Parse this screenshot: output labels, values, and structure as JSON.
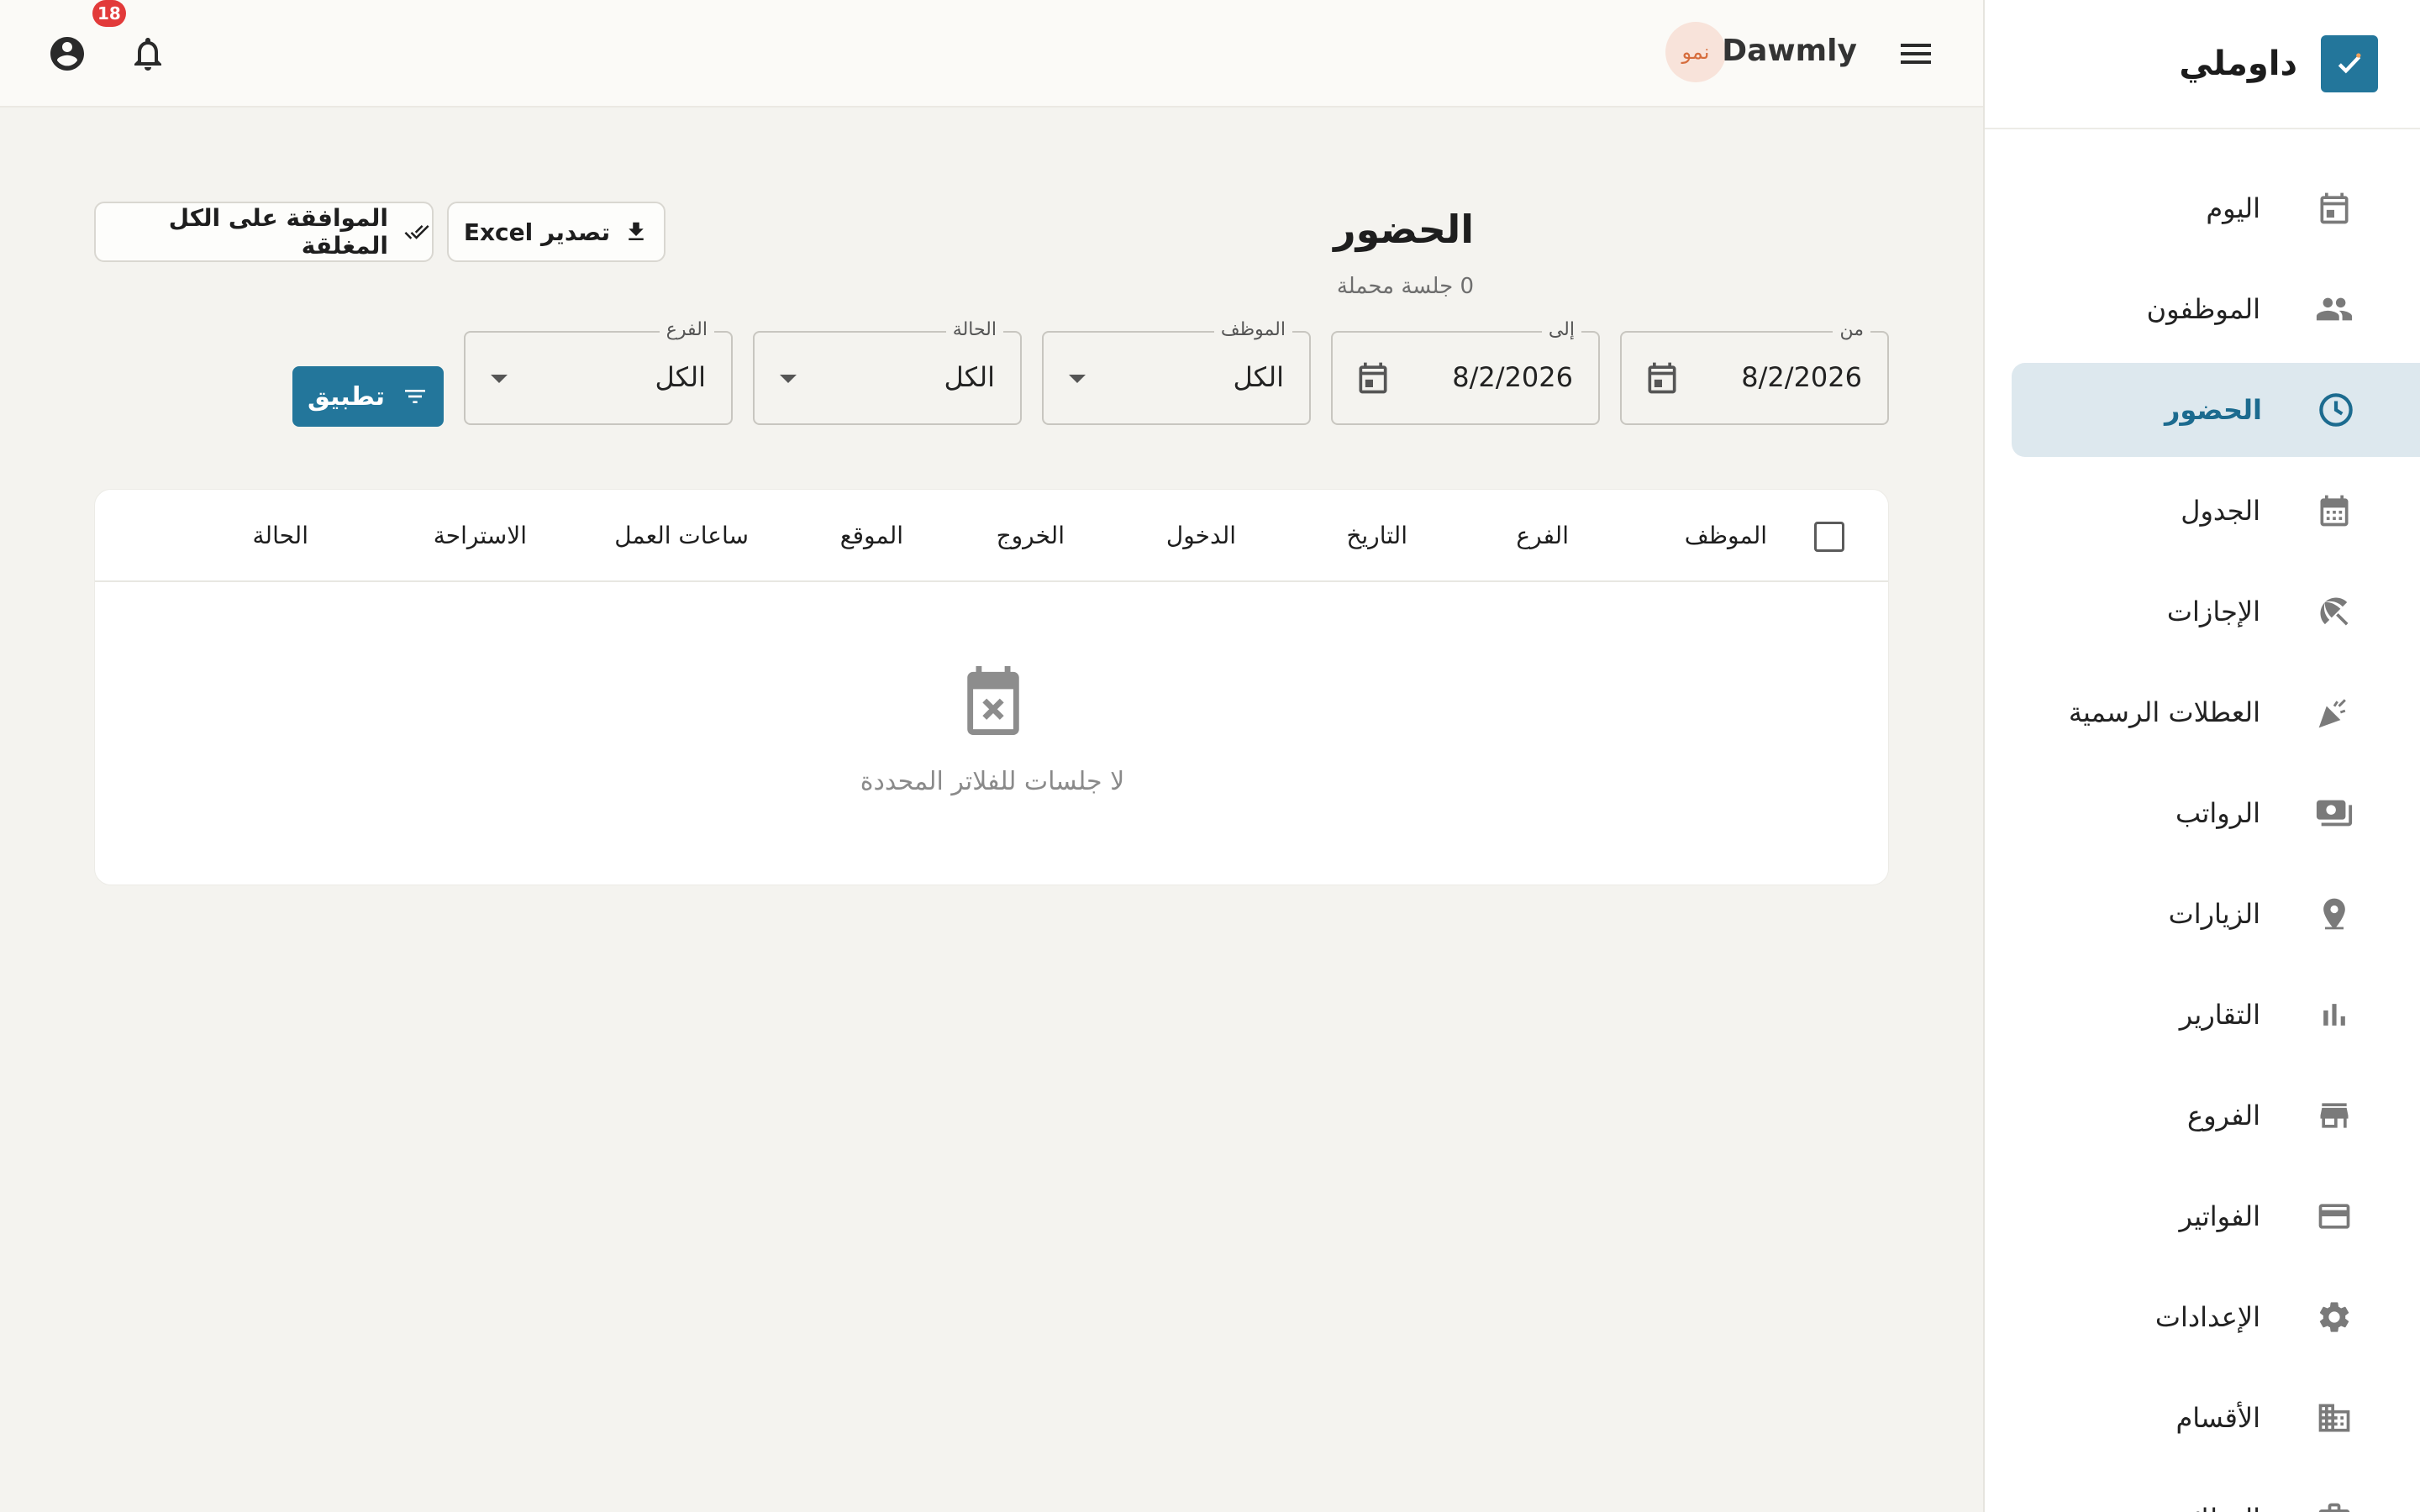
{
  "app": {
    "brand_name": "داوملي",
    "title": "Dawmly",
    "avatar_text": "نمو",
    "notification_count": "18"
  },
  "sidebar": {
    "items": [
      {
        "label": "اليوم",
        "icon": "calendar-today-icon",
        "active": false
      },
      {
        "label": "الموظفون",
        "icon": "people-icon",
        "active": false
      },
      {
        "label": "الحضور",
        "icon": "clock-icon",
        "active": true
      },
      {
        "label": "الجدول",
        "icon": "calendar-grid-icon",
        "active": false
      },
      {
        "label": "الإجازات",
        "icon": "umbrella-icon",
        "active": false
      },
      {
        "label": "العطلات الرسمية",
        "icon": "party-popper-icon",
        "active": false
      },
      {
        "label": "الرواتب",
        "icon": "money-icon",
        "active": false
      },
      {
        "label": "الزيارات",
        "icon": "location-pin-icon",
        "active": false
      },
      {
        "label": "التقارير",
        "icon": "bar-chart-icon",
        "active": false
      },
      {
        "label": "الفروع",
        "icon": "store-icon",
        "active": false
      },
      {
        "label": "الفواتير",
        "icon": "credit-card-icon",
        "active": false
      },
      {
        "label": "الإعدادات",
        "icon": "gear-icon",
        "active": false
      },
      {
        "label": "الأقسام",
        "icon": "building-icon",
        "active": false
      },
      {
        "label": "الوظائف",
        "icon": "briefcase-icon",
        "active": false
      }
    ]
  },
  "page": {
    "title": "الحضور",
    "subtitle": "0 جلسة محملة",
    "export_label": "تصدير Excel",
    "approve_all_label": "الموافقة على الكل المغلقة"
  },
  "filters": {
    "from_label": "من",
    "from_value": "8/2/2026",
    "to_label": "إلى",
    "to_value": "8/2/2026",
    "employee_label": "الموظف",
    "employee_value": "الكل",
    "status_label": "الحالة",
    "status_value": "الكل",
    "branch_label": "الفرع",
    "branch_value": "الكل",
    "apply_label": "تطبيق"
  },
  "table": {
    "headers": [
      "الموظف",
      "الفرع",
      "التاريخ",
      "الدخول",
      "الخروج",
      "الموقع",
      "ساعات العمل",
      "الاستراحة",
      "الحالة"
    ],
    "empty_text": "لا جلسات للفلاتر المحددة"
  },
  "colors": {
    "accent": "#23769b",
    "active_bg": "#dde8ee",
    "badge": "#e23a3a",
    "background": "#f4f3ef"
  }
}
